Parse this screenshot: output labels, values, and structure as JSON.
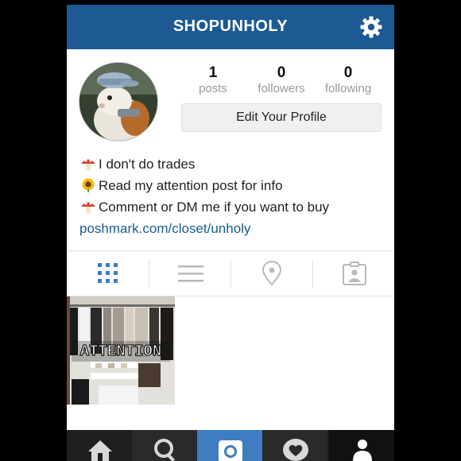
{
  "header": {
    "title": "SHOPUNHOLY",
    "settings_icon": "gear-icon",
    "bg_color": "#1d5a93"
  },
  "profile": {
    "stats": [
      {
        "value": "1",
        "label": "posts"
      },
      {
        "value": "0",
        "label": "followers"
      },
      {
        "value": "0",
        "label": "following"
      }
    ],
    "edit_button": "Edit Your Profile",
    "bio": [
      {
        "emoji": "mushroom-emoji",
        "text": "I don't do trades"
      },
      {
        "emoji": "sunflower-emoji",
        "text": "Read my attention post for info"
      },
      {
        "emoji": "mushroom-emoji",
        "text": "Comment or DM me if you want to buy"
      }
    ],
    "link": "poshmark.com/closet/unholy",
    "link_color": "#1d5a93"
  },
  "tabs": [
    {
      "icon": "grid-icon",
      "active": true
    },
    {
      "icon": "list-icon",
      "active": false
    },
    {
      "icon": "location-pin-icon",
      "active": false
    },
    {
      "icon": "tagged-photos-icon",
      "active": false
    }
  ],
  "posts": [
    {
      "overlay_text": "ATTENTION"
    }
  ],
  "bottom_nav": [
    {
      "icon": "home-icon",
      "active": false
    },
    {
      "icon": "search-icon",
      "active": false
    },
    {
      "icon": "camera-icon",
      "active": true
    },
    {
      "icon": "activity-heart-icon",
      "active": false
    },
    {
      "icon": "profile-icon",
      "active": false
    }
  ]
}
